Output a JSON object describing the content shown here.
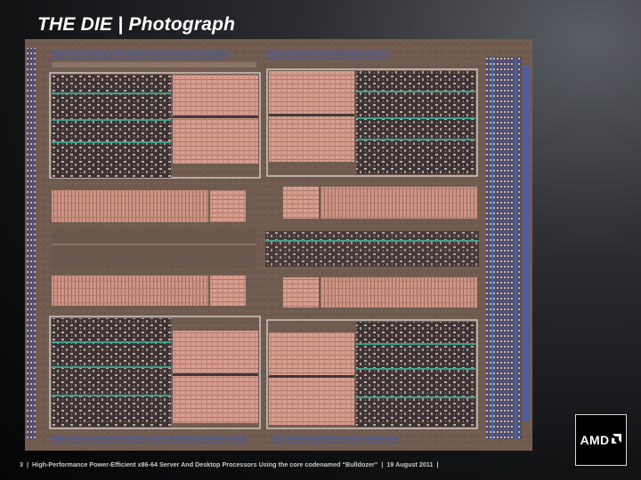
{
  "slide": {
    "title": "THE DIE | Photograph"
  },
  "image": {
    "subject": "die-photograph-icon"
  },
  "footer": {
    "page_number": "3",
    "presentation": "High-Performance Power-Efficient x86-64 Server And Desktop Processors Using the core codenamed “Bulldozer”",
    "date": "19 August  2011",
    "separator": "|"
  },
  "logo": {
    "text": "AMD",
    "icon": "amd-arrow-icon"
  },
  "colors": {
    "die_base": "#6f5a4f",
    "cache_pink": "#d59a8c",
    "logic_dark": "#3b3334",
    "accent_teal": "#3fa08c",
    "io_blue": "#3a4a8a"
  }
}
